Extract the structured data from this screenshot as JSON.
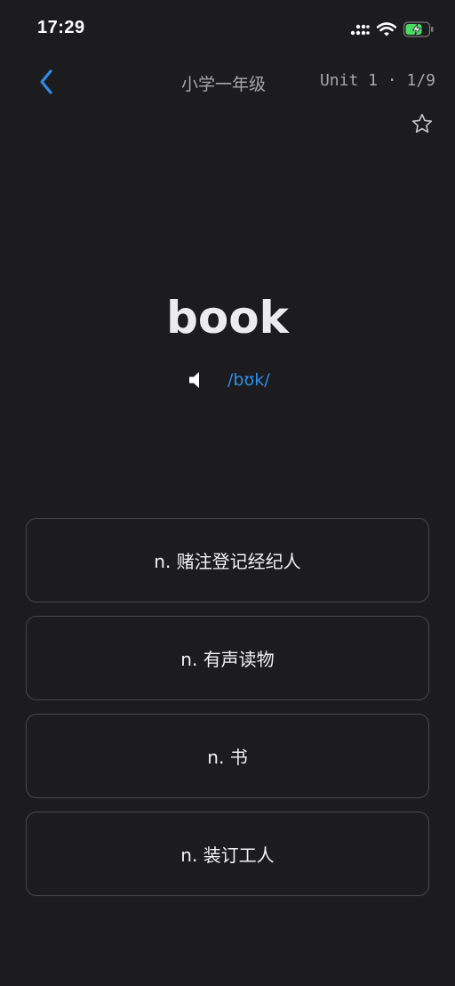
{
  "status_bar": {
    "time": "17:29"
  },
  "nav": {
    "title": "小学一年级",
    "progress": "Unit 1 · 1/9"
  },
  "word": {
    "text": "book",
    "phonetic": "/bʊk/"
  },
  "options": [
    {
      "label": "n. 赌注登记经纪人"
    },
    {
      "label": "n. 有声读物"
    },
    {
      "label": "n. 书"
    },
    {
      "label": "n. 装订工人"
    }
  ],
  "colors": {
    "background": "#1c1c1e",
    "accent": "#2e8ce6",
    "battery": "#4cd964"
  },
  "icons": {
    "back": "chevron-left-icon",
    "favorite": "star-outline-icon",
    "audio": "speaker-icon",
    "signal": "cellular-signal-icon",
    "wifi": "wifi-icon",
    "battery": "battery-charging-icon"
  }
}
